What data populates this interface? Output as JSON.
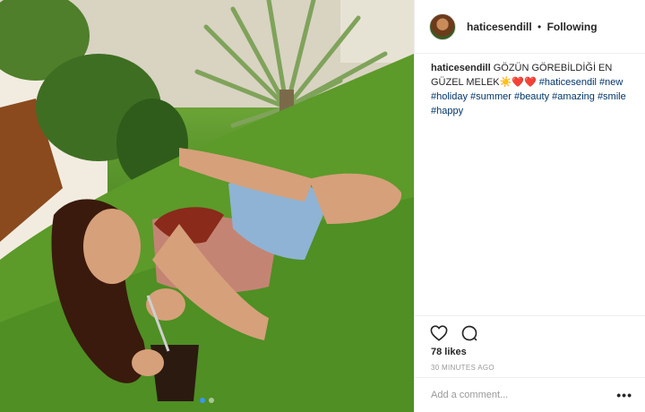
{
  "post": {
    "username": "haticesendill",
    "follow_separator": "•",
    "follow_status": "Following"
  },
  "caption": {
    "username": "haticesendill",
    "text": "GÖZÜN GÖREBİLDİĞİ EN GÜZEL MELEK☀️❤️❤️",
    "hashtags": [
      "#haticesendil",
      "#new",
      "#holiday",
      "#summer",
      "#beauty",
      "#amazing",
      "#smile",
      "#happy"
    ]
  },
  "actions": {
    "like_icon": "heart-outline-icon",
    "comment_icon": "comment-bubble-icon"
  },
  "stats": {
    "likes": "78 likes",
    "time_ago": "30 MINUTES AGO"
  },
  "comment": {
    "placeholder": "Add a comment...",
    "more_label": "•••"
  },
  "carousel": {
    "total": 2,
    "active": 0
  },
  "colors": {
    "link": "#003569",
    "muted": "#999999",
    "border": "#efefef",
    "active_dot": "#3897f0"
  }
}
